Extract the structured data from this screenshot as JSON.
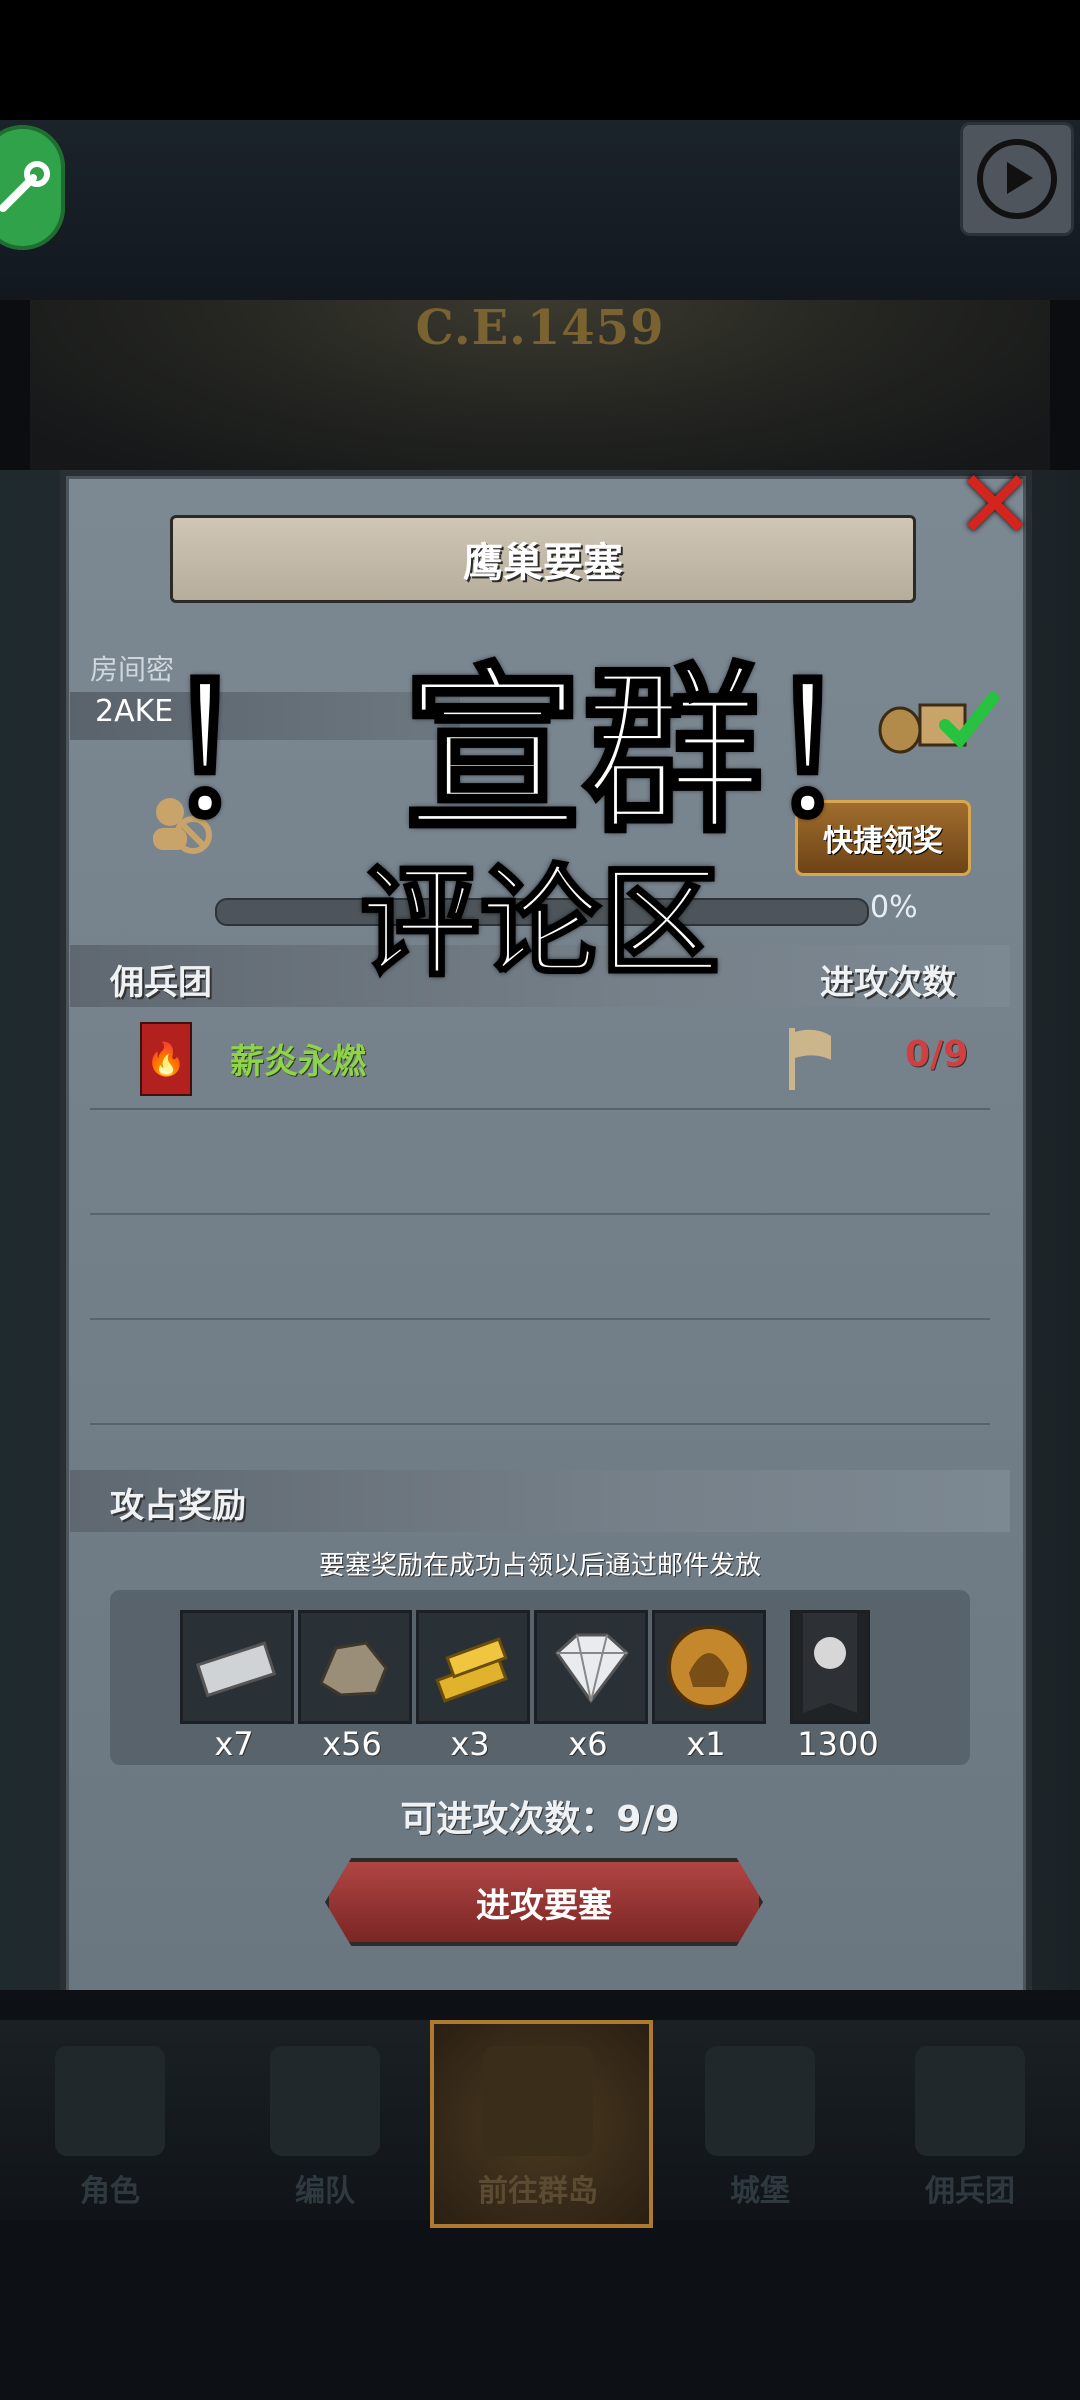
{
  "header": {
    "era": "C.E.1459"
  },
  "panel": {
    "title": "鹰巢要塞",
    "room_label": "房间密",
    "room_code": "2AKE",
    "quick_claim": "快捷领奖",
    "progress_text": "0%",
    "progress_value": 0.0
  },
  "mercenary": {
    "header": "佣兵团",
    "attack_header": "进攻次数",
    "rows": [
      {
        "name": "薪炎永燃",
        "attacks": "0/9"
      }
    ]
  },
  "rewards": {
    "header": "攻占奖励",
    "note": "要塞奖励在成功占领以后通过邮件发放",
    "items": [
      {
        "icon": "silver-bar-icon",
        "label": "x7"
      },
      {
        "icon": "stone-icon",
        "label": "x56"
      },
      {
        "icon": "gold-bars-icon",
        "label": "x3"
      },
      {
        "icon": "diamond-icon",
        "label": "x6"
      },
      {
        "icon": "helmet-medal-icon",
        "label": "x1"
      },
      {
        "icon": "banner-token-icon",
        "label": "1300"
      }
    ],
    "attacks_left": "可进攻次数：9/9",
    "attack_button": "进攻要塞"
  },
  "bottom_nav": [
    {
      "label": "角色"
    },
    {
      "label": "编队"
    },
    {
      "label": "前往群岛"
    },
    {
      "label": "城堡"
    },
    {
      "label": "佣兵团"
    }
  ],
  "overlay": {
    "big": "！ 宣群！",
    "mid": "评论区"
  },
  "colors": {
    "green_button": "#2fa24a",
    "panel_bg": "#7c8892",
    "attack_count_red": "#d04040",
    "merc_name_green": "#8fd34a",
    "close_red": "#d3241d",
    "attack_button": "#b04543"
  }
}
